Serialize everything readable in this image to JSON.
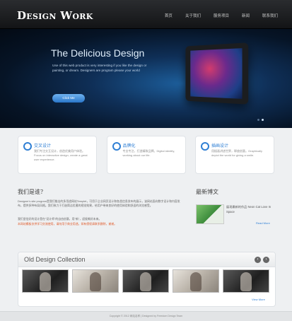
{
  "header": {
    "logo": "Design Work",
    "nav": [
      "首页",
      "关于我们",
      "服务项目",
      "新闻",
      "联系我们"
    ]
  },
  "hero": {
    "title": "The Delicious Design",
    "text": "Use of this web product is very interesting if you like the design or painting, or dream. Designers are program please your world",
    "button": "Click Me"
  },
  "features": [
    {
      "icon": "sync-icon",
      "title": "交叉设计",
      "desc": "我们专注交互设计，创造优美用户体验。Focus on interactive design, create a great user experience."
    },
    {
      "icon": "refresh-icon",
      "title": "品牌化",
      "desc": "专业专注，打造精致品牌。Digital identity, working about our life."
    },
    {
      "icon": "recycle-icon",
      "title": "插画设计",
      "desc": "用插画讲述世界，释放创意。Graphically depict the world for giving a smile."
    }
  ],
  "about": {
    "title": "我们是谁？",
    "text": "Designer's site program是我们推出的多用途网站Templet，可用于企业网页设计和各类信息发布的展示，该网站面向数字设计和内容发布，提供多种布局风格。我们致力于打造简洁优雅的视觉效果，给用户带来良好的使用体验和舒适的浏览感受。",
    "text2": "我们坚信好的设计是在\"设计师\"的自由创意，用\"新\"，迎接美好未来。",
    "red": "本网站模板仅供学习交流使用，请勿用于商业用途。如有侵权请联系删除，谢谢。"
  },
  "news": {
    "title": "最新博文",
    "item": "展现最新的作品 Neon Cat Love In Space",
    "read_more": "Read More"
  },
  "collection": {
    "title": "Old Design Collection",
    "prev": "‹",
    "next": "›",
    "thumbs": [
      "dark",
      "light",
      "dark",
      "light",
      "dark"
    ],
    "view_more": "View More"
  },
  "footer": "Copyright © 2012 网站名称 | Designed by Freedom Design Team"
}
